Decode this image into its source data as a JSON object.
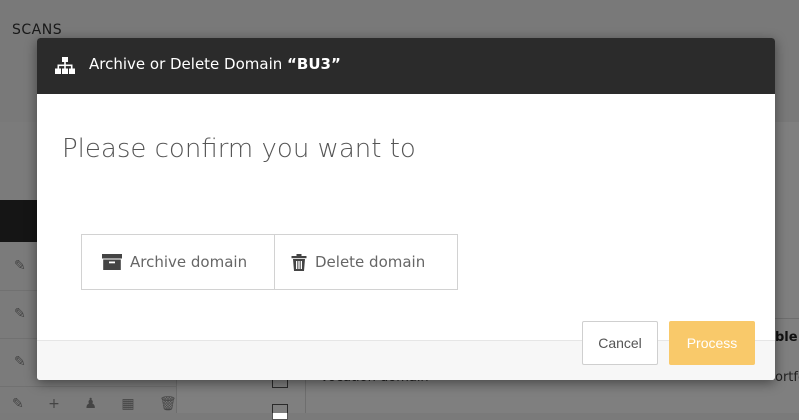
{
  "background": {
    "section_title": "SCANS",
    "table_header_right": "ble",
    "table_cell_right": "ortfo",
    "table_cell_text": "Vocation domain",
    "actions_glyphs": "✎ + ♟ ▦ 🗑"
  },
  "modal": {
    "title_prefix": "Archive or Delete Domain",
    "domain_name": "“BU3”",
    "confirm_text": "Please confirm you want to",
    "options": {
      "archive": {
        "label": "Archive domain",
        "icon": "archive-box-icon"
      },
      "delete": {
        "label": "Delete domain",
        "icon": "trash-icon"
      }
    },
    "cancel_label": "Cancel",
    "process_label": "Process",
    "process_color": "#f9c96a",
    "header_color": "#2b2b2b"
  }
}
